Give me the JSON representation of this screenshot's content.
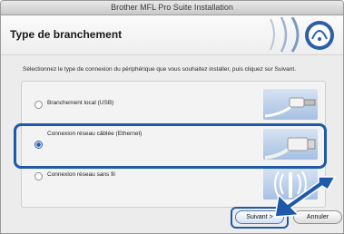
{
  "window": {
    "title": "Brother MFL Pro Suite Installation"
  },
  "header": {
    "title": "Type de branchement"
  },
  "instructions": "Sélectionnez le type de connexion du périphérique que vous souhaitez installer, puis cliquez sur Suivant.",
  "options": [
    {
      "label": "Branchement local (USB)",
      "selected": false,
      "icon": "usb-cable-icon"
    },
    {
      "label": "Connexion réseau câblée (Ethernet)",
      "selected": true,
      "icon": "ethernet-cable-icon"
    },
    {
      "label": "Connexion réseau sans fil",
      "selected": false,
      "icon": "wireless-icon"
    }
  ],
  "buttons": {
    "next": "Suivant >",
    "cancel": "Annuler"
  },
  "colors": {
    "highlight": "#1e5aa8",
    "arrow": "#1e5aa8"
  }
}
